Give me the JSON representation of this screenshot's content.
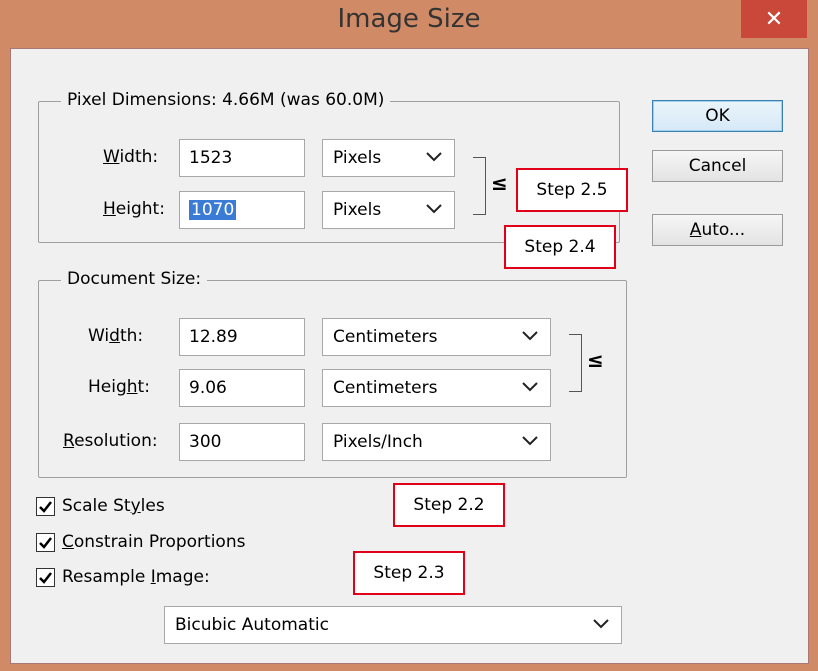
{
  "window": {
    "title": "Image Size",
    "close_label": "✕"
  },
  "pixel_dimensions": {
    "legend": "Pixel Dimensions:  4.66M (was 60.0M)",
    "width_label_prefix": "W",
    "width_label_rest": "idth:",
    "width_value": "1523",
    "width_unit": "Pixels",
    "height_label_prefix": "H",
    "height_label_rest": "eight:",
    "height_value": "1070",
    "height_unit": "Pixels"
  },
  "document_size": {
    "legend": "Document Size:",
    "width_label_a": "Wi",
    "width_label_u": "d",
    "width_label_b": "th:",
    "width_value": "12.89",
    "width_unit": "Centimeters",
    "height_label_a": "Heig",
    "height_label_u": "h",
    "height_label_b": "t:",
    "height_value": "9.06",
    "height_unit": "Centimeters",
    "resolution_label_u": "R",
    "resolution_label_rest": "esolution:",
    "resolution_value": "300",
    "resolution_unit": "Pixels/Inch"
  },
  "buttons": {
    "ok": "OK",
    "cancel": "Cancel",
    "auto_u": "A",
    "auto_rest": "uto..."
  },
  "checkboxes": {
    "scale_styles_a": "Scale St",
    "scale_styles_u": "y",
    "scale_styles_b": "les",
    "constrain_u": "C",
    "constrain_rest": "onstrain Proportions",
    "resample_a": "Resample ",
    "resample_u": "I",
    "resample_b": "mage:",
    "scale_styles_checked": true,
    "constrain_checked": true,
    "resample_checked": true
  },
  "resample_method": "Bicubic Automatic",
  "annotations": {
    "step_2_5": "Step 2.5",
    "step_2_4": "Step 2.4",
    "step_2_2": "Step 2.2",
    "step_2_3": "Step 2.3"
  },
  "colors": {
    "frame": "#d18a66",
    "close": "#c9483a",
    "annotation_border": "#e0001a",
    "selection": "#3a7bd5"
  }
}
